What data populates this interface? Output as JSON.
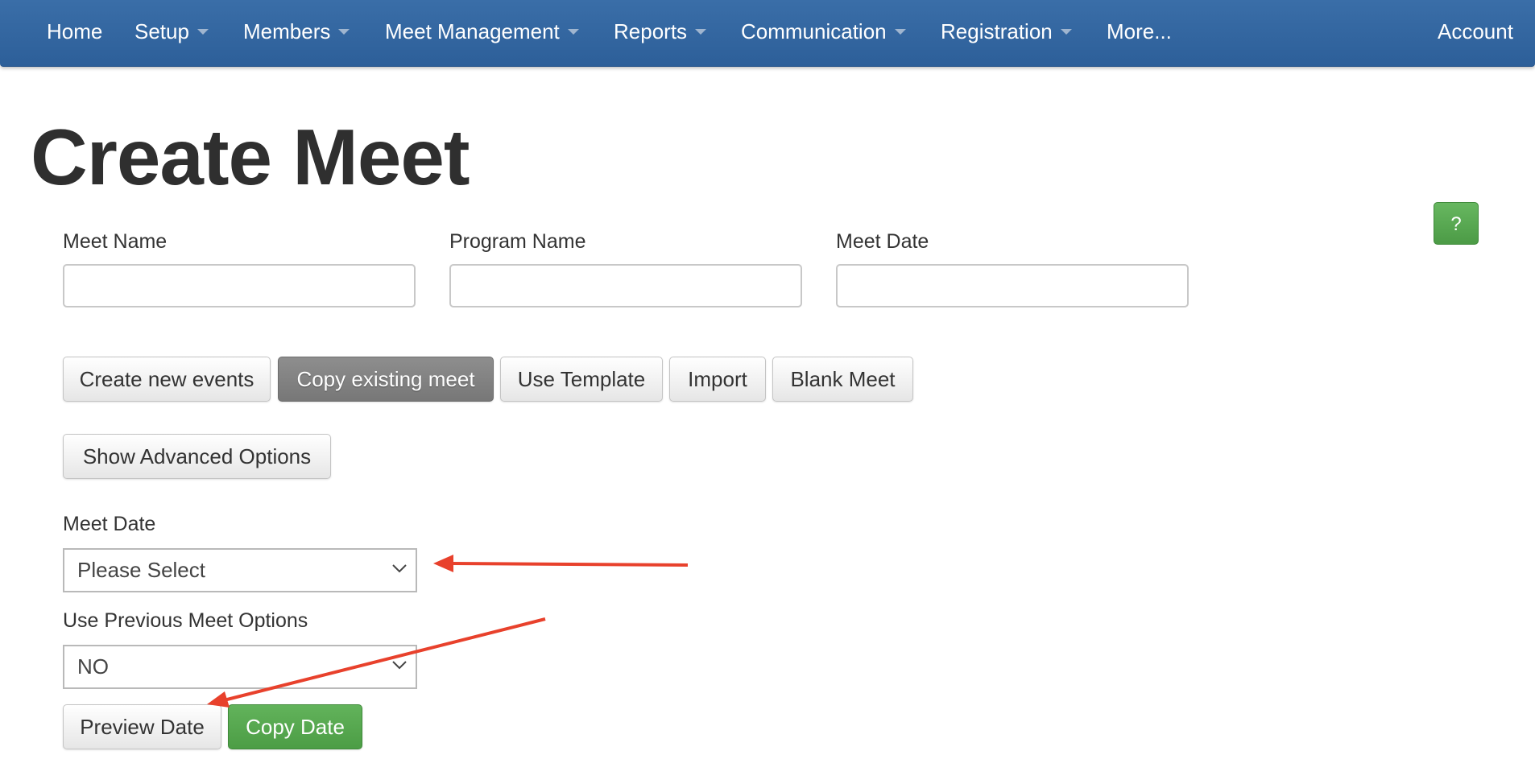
{
  "nav": {
    "items": [
      {
        "label": "Home",
        "dropdown": false
      },
      {
        "label": "Setup",
        "dropdown": true
      },
      {
        "label": "Members",
        "dropdown": true
      },
      {
        "label": "Meet Management",
        "dropdown": true
      },
      {
        "label": "Reports",
        "dropdown": true
      },
      {
        "label": "Communication",
        "dropdown": true
      },
      {
        "label": "Registration",
        "dropdown": true
      },
      {
        "label": "More...",
        "dropdown": false
      }
    ],
    "account_label": "Account"
  },
  "page": {
    "title": "Create Meet",
    "help_label": "?"
  },
  "form": {
    "meet_name_label": "Meet Name",
    "meet_name_value": "",
    "program_name_label": "Program Name",
    "program_name_value": "",
    "meet_date_label": "Meet Date",
    "meet_date_value": ""
  },
  "mode_buttons": [
    {
      "label": "Create new events",
      "active": false
    },
    {
      "label": "Copy existing meet",
      "active": true
    },
    {
      "label": "Use Template",
      "active": false
    },
    {
      "label": "Import",
      "active": false
    },
    {
      "label": "Blank Meet",
      "active": false
    }
  ],
  "advanced_options_label": "Show Advanced Options",
  "copy_section": {
    "meet_date_label": "Meet Date",
    "meet_date_selected": "Please Select",
    "previous_options_label": "Use Previous Meet Options",
    "previous_options_selected": "NO",
    "preview_button_label": "Preview Date",
    "copy_button_label": "Copy Date"
  },
  "colors": {
    "nav_bg": "#2f619b",
    "success": "#5cb85c",
    "active_button": "#7f7f7f",
    "annotation_arrow": "#e8412c"
  }
}
